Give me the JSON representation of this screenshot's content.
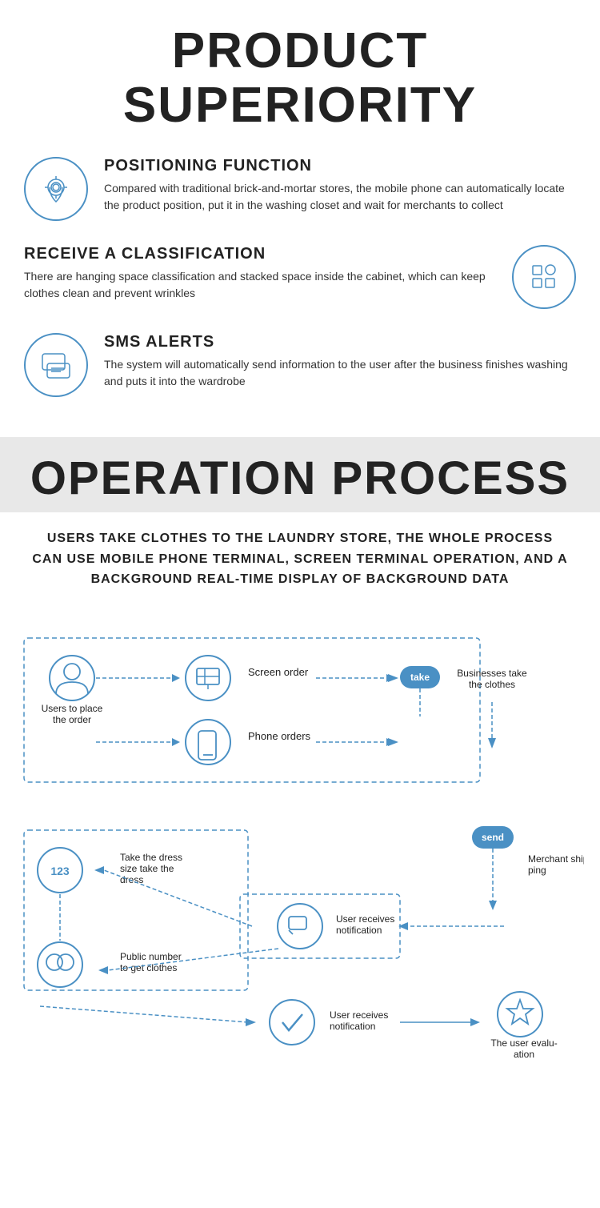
{
  "product_superiority": {
    "title": "PRODUCT\nSUPERIORITY",
    "features": [
      {
        "id": "positioning",
        "title": "POSITIONING FUNCTION",
        "description": "Compared with traditional brick-and-mortar stores, the mobile phone can automatically locate the product position, put it in the washing closet and wait for merchants to collect",
        "icon": "location"
      },
      {
        "id": "classification",
        "title": "RECEIVE A CLASSIFICATION",
        "description": "There are hanging space classification and stacked space inside the cabinet, which can keep clothes clean and prevent wrinkles",
        "icon": "grid",
        "icon_right": true
      },
      {
        "id": "sms",
        "title": "SMS ALERTS",
        "description": "The system will automatically send information to the user after the business finishes washing and puts it into the wardrobe",
        "icon": "message"
      }
    ]
  },
  "operation_process": {
    "section_title": "OPERATION PROCESS",
    "description": "USERS TAKE CLOTHES TO THE LAUNDRY STORE, THE WHOLE PROCESS CAN USE MOBILE PHONE TERMINAL, SCREEN TERMINAL OPERATION, AND A BACKGROUND REAL-TIME DISPLAY OF BACKGROUND DATA",
    "flow_nodes": [
      {
        "id": "user_order",
        "label": "Users to place\nthe order",
        "icon": "user",
        "badge": null
      },
      {
        "id": "screen_order",
        "label": "Screen order",
        "icon": "screen",
        "badge": null
      },
      {
        "id": "businesses_take",
        "label": "Businesses take\nthe clothes",
        "icon": null,
        "badge": "take"
      },
      {
        "id": "phone_orders",
        "label": "Phone orders",
        "icon": "phone",
        "badge": null
      },
      {
        "id": "take_dress",
        "label": "Take the dress\nsize take the\ndress",
        "icon": "123",
        "badge": null
      },
      {
        "id": "user_receives_1",
        "label": "User receives\nnotification",
        "icon": "chat",
        "badge": null
      },
      {
        "id": "merchant_shipping",
        "label": "Merchant ship-\nping",
        "icon": null,
        "badge": "send"
      },
      {
        "id": "public_number",
        "label": "Public number\nto get clothes",
        "icon": "wechat",
        "badge": null
      },
      {
        "id": "user_receives_2",
        "label": "User receives\nnotification",
        "icon": "check",
        "badge": null
      },
      {
        "id": "user_evaluation",
        "label": "The user evalu-\nation",
        "icon": "star",
        "badge": null
      }
    ]
  }
}
